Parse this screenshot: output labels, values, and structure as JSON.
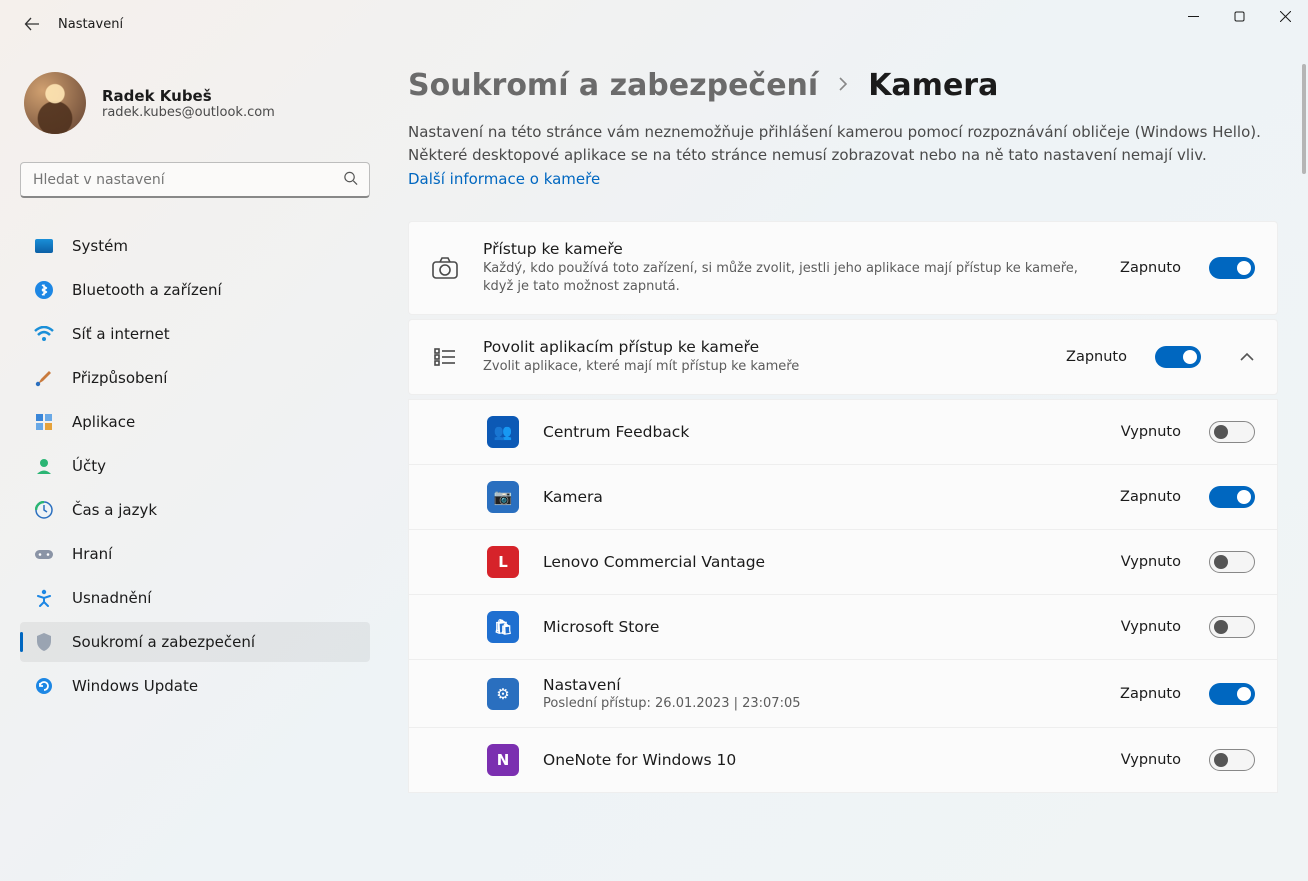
{
  "window": {
    "title": "Nastavení"
  },
  "user": {
    "name": "Radek Kubeš",
    "email": "radek.kubes@outlook.com"
  },
  "search": {
    "placeholder": "Hledat v nastavení"
  },
  "sidebar": {
    "items": [
      {
        "label": "Systém"
      },
      {
        "label": "Bluetooth a zařízení"
      },
      {
        "label": "Síť a internet"
      },
      {
        "label": "Přizpůsobení"
      },
      {
        "label": "Aplikace"
      },
      {
        "label": "Účty"
      },
      {
        "label": "Čas a jazyk"
      },
      {
        "label": "Hraní"
      },
      {
        "label": "Usnadnění"
      },
      {
        "label": "Soukromí a zabezpečení"
      },
      {
        "label": "Windows Update"
      }
    ]
  },
  "breadcrumb": {
    "parent": "Soukromí a zabezpečení",
    "current": "Kamera"
  },
  "description": "Nastavení na této stránce vám neznemožňuje přihlášení kamerou pomocí rozpoznávání obličeje (Windows Hello). Některé desktopové aplikace se na této stránce nemusí zobrazovat nebo na ně tato nastavení nemají vliv.",
  "description_link": "Další informace o kameře",
  "labels": {
    "on": "Zapnuto",
    "off": "Vypnuto"
  },
  "access": {
    "title": "Přístup ke kameře",
    "sub": "Každý, kdo používá toto zařízení, si může zvolit, jestli jeho aplikace mají přístup ke kameře, když je tato možnost zapnutá.",
    "state": "Zapnuto"
  },
  "allow": {
    "title": "Povolit aplikacím přístup ke kameře",
    "sub": "Zvolit aplikace, které mají mít přístup ke kameře",
    "state": "Zapnuto"
  },
  "apps": [
    {
      "name": "Centrum Feedback",
      "state": "Vypnuto",
      "on": false,
      "color": "#0c59b5",
      "glyph": "👥"
    },
    {
      "name": "Kamera",
      "state": "Zapnuto",
      "on": true,
      "color": "#2a6fbf",
      "glyph": "📷"
    },
    {
      "name": "Lenovo Commercial Vantage",
      "state": "Vypnuto",
      "on": false,
      "color": "#d6232a",
      "glyph": "L"
    },
    {
      "name": "Microsoft Store",
      "state": "Vypnuto",
      "on": false,
      "color": "#1f6fd0",
      "glyph": "🛍"
    },
    {
      "name": "Nastavení",
      "sub": "Poslední přístup:  26.01.2023  |  23:07:05",
      "state": "Zapnuto",
      "on": true,
      "color": "#2a6fbf",
      "glyph": "⚙"
    },
    {
      "name": "OneNote for Windows 10",
      "state": "Vypnuto",
      "on": false,
      "color": "#7b2fb0",
      "glyph": "N"
    }
  ]
}
